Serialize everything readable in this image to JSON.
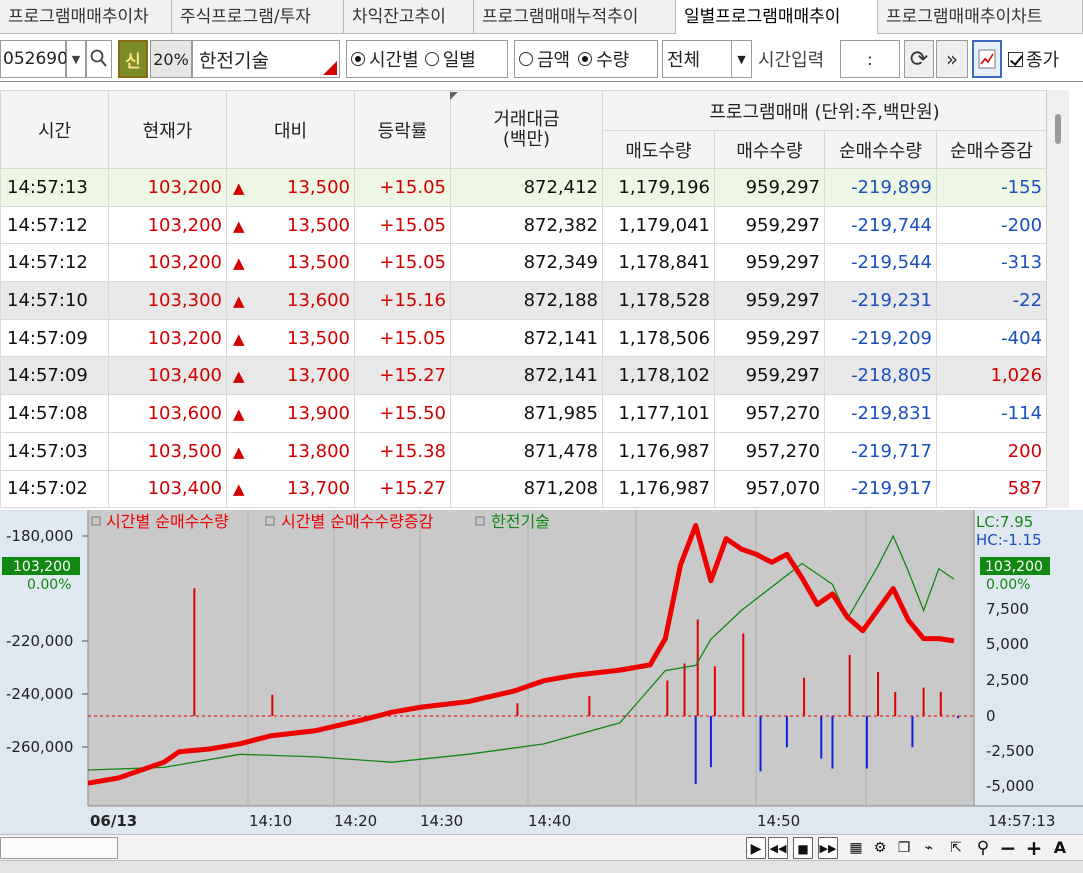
{
  "tabs": [
    {
      "label": "프로그램매매추이차"
    },
    {
      "label": "주식프로그램/투자"
    },
    {
      "label": "차익잔고추이"
    },
    {
      "label": "프로그램매매누적추이"
    },
    {
      "label": "일별프로그램매매추이"
    },
    {
      "label": "프로그램매매추이차트"
    }
  ],
  "toolbar": {
    "code": "052690",
    "shin_label": "신",
    "pct_label": "20%",
    "stock_name": "한전기술",
    "radio_time_label": "시간별",
    "radio_day_label": "일별",
    "radio_amount_label": "금액",
    "radio_qty_label": "수량",
    "select_value": "전체",
    "time_input_label": "시간입력",
    "time_input_value": ":",
    "close_check_label": "종가"
  },
  "table": {
    "headers": {
      "time": "시간",
      "price": "현재가",
      "change": "대비",
      "rate": "등락률",
      "amount": "거래대금",
      "amount_unit": "(백만)",
      "program": "프로그램매매 (단위:주,백만원)",
      "sell_qty": "매도수량",
      "buy_qty": "매수수량",
      "net_qty": "순매수수량",
      "net_chg": "순매수증감"
    },
    "rows": [
      {
        "time": "14:57:13",
        "price": "103,200",
        "change": "13,500",
        "rate": "+15.05",
        "amount": "872,412",
        "sell": "1,179,196",
        "buy": "959,297",
        "net": "-219,899",
        "net_chg": "-155",
        "chg_color": "blue"
      },
      {
        "time": "14:57:12",
        "price": "103,200",
        "change": "13,500",
        "rate": "+15.05",
        "amount": "872,382",
        "sell": "1,179,041",
        "buy": "959,297",
        "net": "-219,744",
        "net_chg": "-200",
        "chg_color": "blue"
      },
      {
        "time": "14:57:12",
        "price": "103,200",
        "change": "13,500",
        "rate": "+15.05",
        "amount": "872,349",
        "sell": "1,178,841",
        "buy": "959,297",
        "net": "-219,544",
        "net_chg": "-313",
        "chg_color": "blue"
      },
      {
        "time": "14:57:10",
        "price": "103,300",
        "change": "13,600",
        "rate": "+15.16",
        "amount": "872,188",
        "sell": "1,178,528",
        "buy": "959,297",
        "net": "-219,231",
        "net_chg": "-22",
        "chg_color": "blue"
      },
      {
        "time": "14:57:09",
        "price": "103,200",
        "change": "13,500",
        "rate": "+15.05",
        "amount": "872,141",
        "sell": "1,178,506",
        "buy": "959,297",
        "net": "-219,209",
        "net_chg": "-404",
        "chg_color": "blue"
      },
      {
        "time": "14:57:09",
        "price": "103,400",
        "change": "13,700",
        "rate": "+15.27",
        "amount": "872,141",
        "sell": "1,178,102",
        "buy": "959,297",
        "net": "-218,805",
        "net_chg": "1,026",
        "chg_color": "red"
      },
      {
        "time": "14:57:08",
        "price": "103,600",
        "change": "13,900",
        "rate": "+15.50",
        "amount": "871,985",
        "sell": "1,177,101",
        "buy": "957,270",
        "net": "-219,831",
        "net_chg": "-114",
        "chg_color": "blue"
      },
      {
        "time": "14:57:03",
        "price": "103,500",
        "change": "13,800",
        "rate": "+15.38",
        "amount": "871,478",
        "sell": "1,176,987",
        "buy": "957,270",
        "net": "-219,717",
        "net_chg": "200",
        "chg_color": "red"
      },
      {
        "time": "14:57:02",
        "price": "103,400",
        "change": "13,700",
        "rate": "+15.27",
        "amount": "871,208",
        "sell": "1,176,987",
        "buy": "957,070",
        "net": "-219,917",
        "net_chg": "587",
        "chg_color": "red"
      }
    ]
  },
  "chart_data": {
    "type": "line",
    "legend": [
      {
        "name": "시간별 순매수수량",
        "color": "#ee0000"
      },
      {
        "name": "시간별 순매수수량증감",
        "color": "#ee0000"
      },
      {
        "name": "한전기술",
        "color": "#118811"
      }
    ],
    "left_axis_ticks": [
      "-180,000",
      "-220,000",
      "-240,000",
      "-260,000"
    ],
    "left_price_badge": "103,200",
    "left_pct_label": "0.00%",
    "right_axis_ticks": [
      "7,500",
      "5,000",
      "2,500",
      "0",
      "-2,500",
      "-5,000"
    ],
    "right_price_badge": "103,200",
    "right_pct_label": "0.00%",
    "lc_label": "LC:7.95",
    "hc_label": "HC:-1.15",
    "x_ticks": [
      "14:10",
      "14:20",
      "14:30",
      "14:40",
      "14:50"
    ],
    "date_label": "06/13",
    "last_time_label": "14:57:13",
    "net_qty_series": {
      "name": "시간별 순매수수량",
      "x": [
        "14:00",
        "14:02",
        "14:05",
        "14:06",
        "14:08",
        "14:10",
        "14:12",
        "14:15",
        "14:18",
        "14:20",
        "14:22",
        "14:25",
        "14:28",
        "14:30",
        "14:32",
        "14:35",
        "14:37",
        "14:38",
        "14:39",
        "14:40",
        "14:41",
        "14:42",
        "14:43",
        "14:44",
        "14:45",
        "14:46",
        "14:47",
        "14:48",
        "14:49",
        "14:50",
        "14:51",
        "14:52",
        "14:53",
        "14:54",
        "14:55",
        "14:56",
        "14:57"
      ],
      "y": [
        -274000,
        -272000,
        -266000,
        -262000,
        -261000,
        -259000,
        -256000,
        -254000,
        -250000,
        -247000,
        -245000,
        -243000,
        -239000,
        -235000,
        -233000,
        -231000,
        -229000,
        -219000,
        -191000,
        -176000,
        -197000,
        -181000,
        -185000,
        -187000,
        -190000,
        -187000,
        -196000,
        -206000,
        -202000,
        -211000,
        -216000,
        -208000,
        -200000,
        -212000,
        -219000,
        -219000,
        -219899
      ]
    },
    "price_series": {
      "name": "한전기술",
      "x": [
        "14:00",
        "14:05",
        "14:10",
        "14:15",
        "14:20",
        "14:25",
        "14:30",
        "14:35",
        "14:38",
        "14:40",
        "14:41",
        "14:43",
        "14:45",
        "14:47",
        "14:49",
        "14:50",
        "14:51",
        "14:52",
        "14:53",
        "14:54",
        "14:55",
        "14:56",
        "14:57"
      ],
      "y": [
        -1.0,
        -0.9,
        -0.4,
        -0.5,
        -0.7,
        -0.4,
        0.0,
        0.8,
        2.8,
        3.0,
        4.0,
        5.1,
        6.0,
        6.9,
        6.1,
        4.8,
        5.8,
        6.8,
        7.95,
        6.6,
        5.1,
        6.7,
        6.3
      ]
    },
    "net_change_bars": {
      "name": "시간별 순매수수량증감",
      "x": [
        "14:07",
        "14:12",
        "14:28",
        "14:33",
        "14:38",
        "14:39",
        "14:40",
        "14:40",
        "14:41",
        "14:41",
        "14:43",
        "14:44",
        "14:46",
        "14:47",
        "14:48",
        "14:49",
        "14:50",
        "14:51",
        "14:52",
        "14:53",
        "14:54",
        "14:55",
        "14:56",
        "14:57"
      ],
      "y": [
        9000,
        1500,
        900,
        1400,
        2500,
        3700,
        -4800,
        6800,
        3500,
        -3600,
        5800,
        -3900,
        -2200,
        2700,
        -3000,
        -3700,
        4300,
        -3700,
        3100,
        1700,
        -2200,
        2000,
        1700,
        -155
      ]
    }
  },
  "bottom": {
    "controls": [
      "▶",
      "◀◀",
      "■",
      "▶▶"
    ]
  }
}
